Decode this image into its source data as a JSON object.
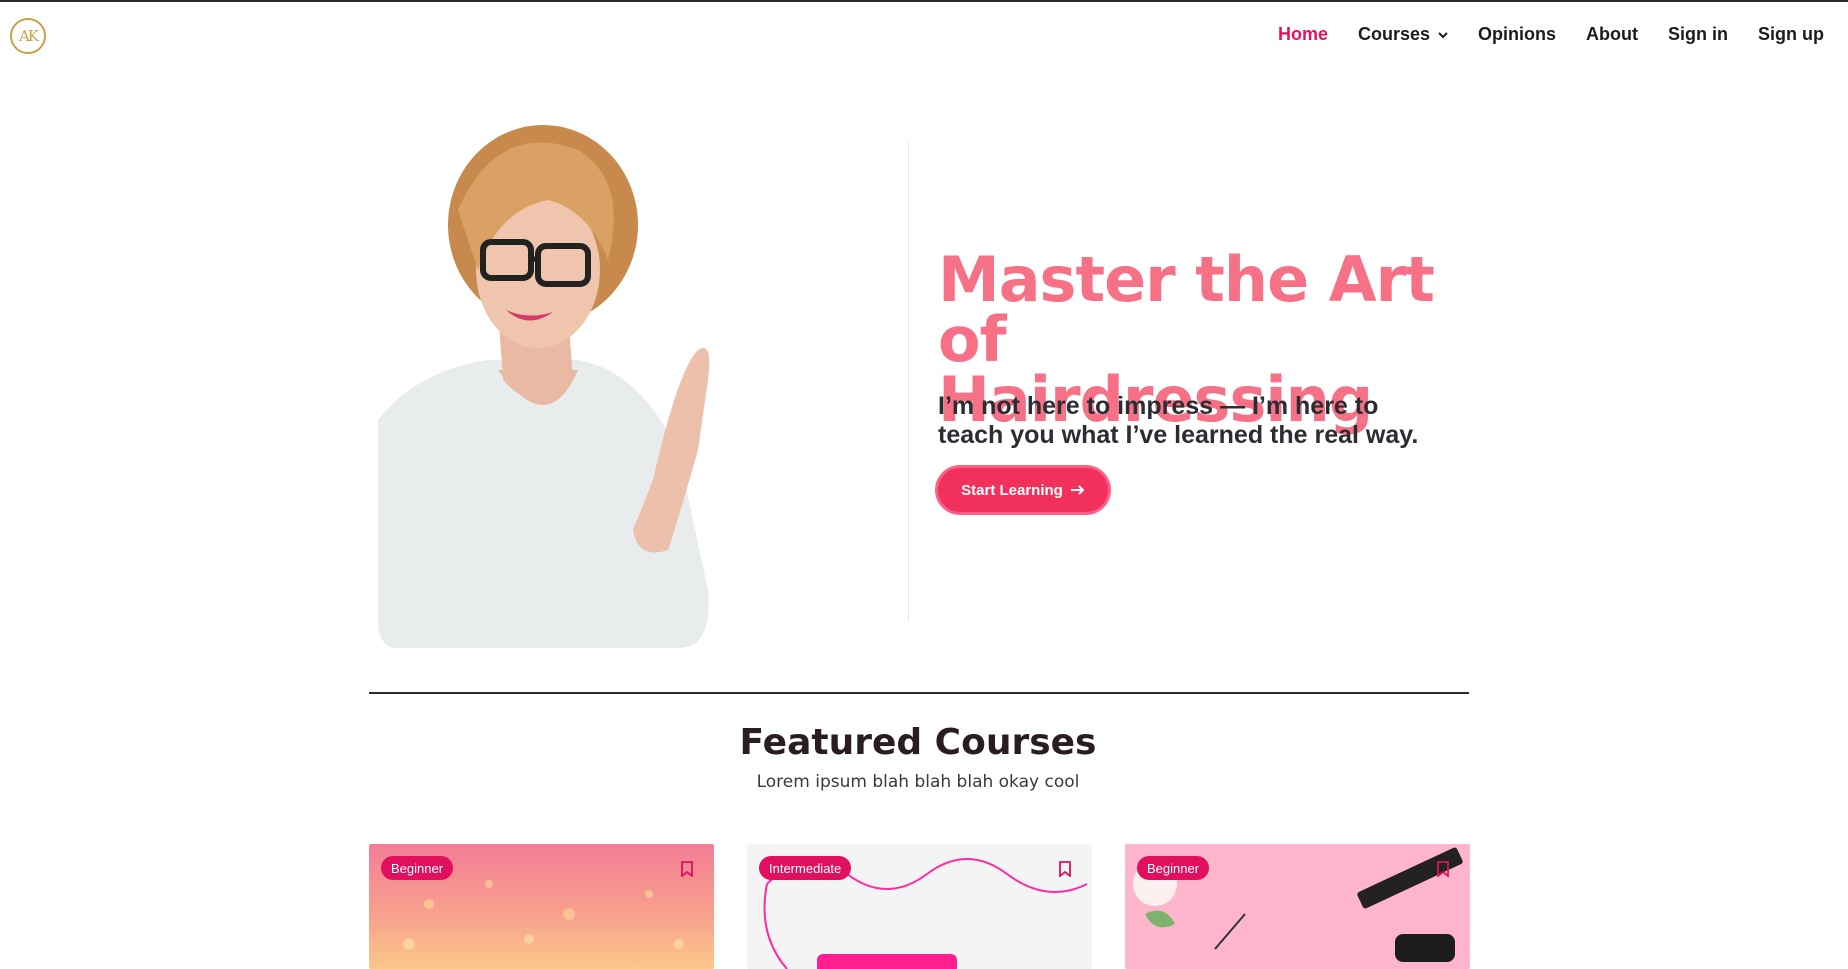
{
  "brand": {
    "logo_text": "AK",
    "accent": "#e6105f",
    "logo_color": "#c9a24a"
  },
  "nav": {
    "items": [
      {
        "label": "Home",
        "active": true
      },
      {
        "label": "Courses",
        "dropdown": true
      },
      {
        "label": "Opinions"
      },
      {
        "label": "About"
      },
      {
        "label": "Sign in"
      },
      {
        "label": "Sign up"
      }
    ]
  },
  "hero": {
    "title_line1": "Master the Art",
    "title_line2": "of Hairdressing",
    "subtitle_line1": "I’m not here to impress — I’m here to",
    "subtitle_line2": "teach you what I’ve learned the real way.",
    "cta_label": "Start Learning",
    "cta_icon": "arrow-right-icon",
    "title_color": "#f67186",
    "cta_color": "#f2305c"
  },
  "featured": {
    "title": "Featured Courses",
    "subtitle": "Lorem ipsum blah blah blah okay cool",
    "cards": [
      {
        "level": "Beginner",
        "icon": "bookmark-icon"
      },
      {
        "level": "Intermediate",
        "icon": "bookmark-icon"
      },
      {
        "level": "Beginner",
        "icon": "bookmark-icon"
      }
    ]
  }
}
